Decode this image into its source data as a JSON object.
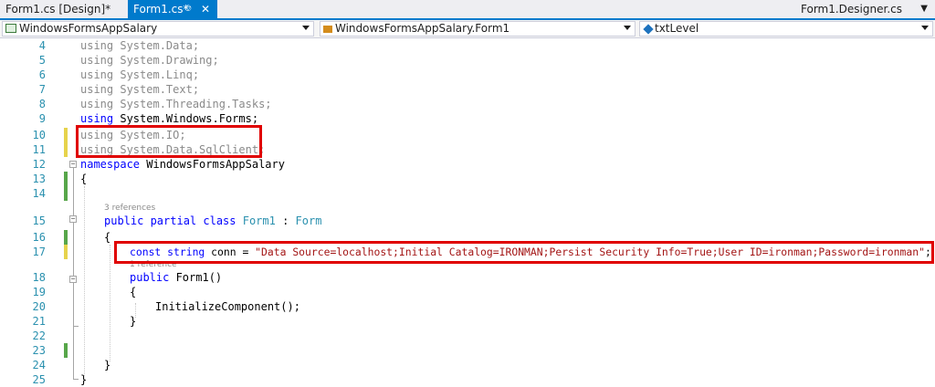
{
  "tabs": {
    "design_tab": "Form1.cs [Design]*",
    "active_tab": "Form1.cs*",
    "right_tab": "Form1.Designer.cs"
  },
  "navbar": {
    "project": "WindowsFormsAppSalary",
    "class": "WindowsFormsAppSalary.Form1",
    "member": "txtLevel"
  },
  "lines": {
    "l4": {
      "num": "4",
      "p1": "using ",
      "p2": "System.Data;"
    },
    "l5": {
      "num": "5",
      "p1": "using ",
      "p2": "System.Drawing;"
    },
    "l6": {
      "num": "6",
      "p1": "using ",
      "p2": "System.Linq;"
    },
    "l7": {
      "num": "7",
      "p1": "using ",
      "p2": "System.Text;"
    },
    "l8": {
      "num": "8",
      "p1": "using ",
      "p2": "System.Threading.Tasks;"
    },
    "l9": {
      "num": "9",
      "p1": "using ",
      "p2": "System.Windows.Forms;"
    },
    "l10": {
      "num": "10",
      "p1": "using ",
      "p2": "System.IO;"
    },
    "l11": {
      "num": "11",
      "p1": "using ",
      "p2": "System.Data.SqlClient;"
    },
    "l12": {
      "num": "12",
      "p1": "namespace ",
      "p2": "WindowsFormsAppSalary"
    },
    "l13": {
      "num": "13",
      "p1": "{"
    },
    "l14": {
      "num": "14"
    },
    "refs15": "3 references",
    "l15": {
      "num": "15",
      "p1": "public partial class ",
      "p2": "Form1",
      "p3": " : ",
      "p4": "Form"
    },
    "l16": {
      "num": "16",
      "p1": "{"
    },
    "l17": {
      "num": "17",
      "p1": "const string ",
      "p2": "conn = ",
      "p3": "\"Data Source=localhost;Initial Catalog=IRONMAN;Persist Security Info=True;User ID=ironman;Password=ironman\"",
      "p4": ";"
    },
    "refs18": "1 reference",
    "l18": {
      "num": "18",
      "p1": "public ",
      "p2": "Form1()"
    },
    "l19": {
      "num": "19",
      "p1": "{"
    },
    "l20": {
      "num": "20",
      "p1": "InitializeComponent();"
    },
    "l21": {
      "num": "21",
      "p1": "}"
    },
    "l22": {
      "num": "22"
    },
    "l23": {
      "num": "23"
    },
    "l24": {
      "num": "24",
      "p1": "}"
    },
    "l25": {
      "num": "25",
      "p1": "}"
    }
  },
  "colors": {
    "accent": "#007acc",
    "keyword": "#0000ff",
    "type": "#2b91af",
    "string": "#a31515",
    "highlight_box": "#e00000",
    "change_saved": "#57a64a",
    "change_unsaved": "#e6d34c"
  }
}
